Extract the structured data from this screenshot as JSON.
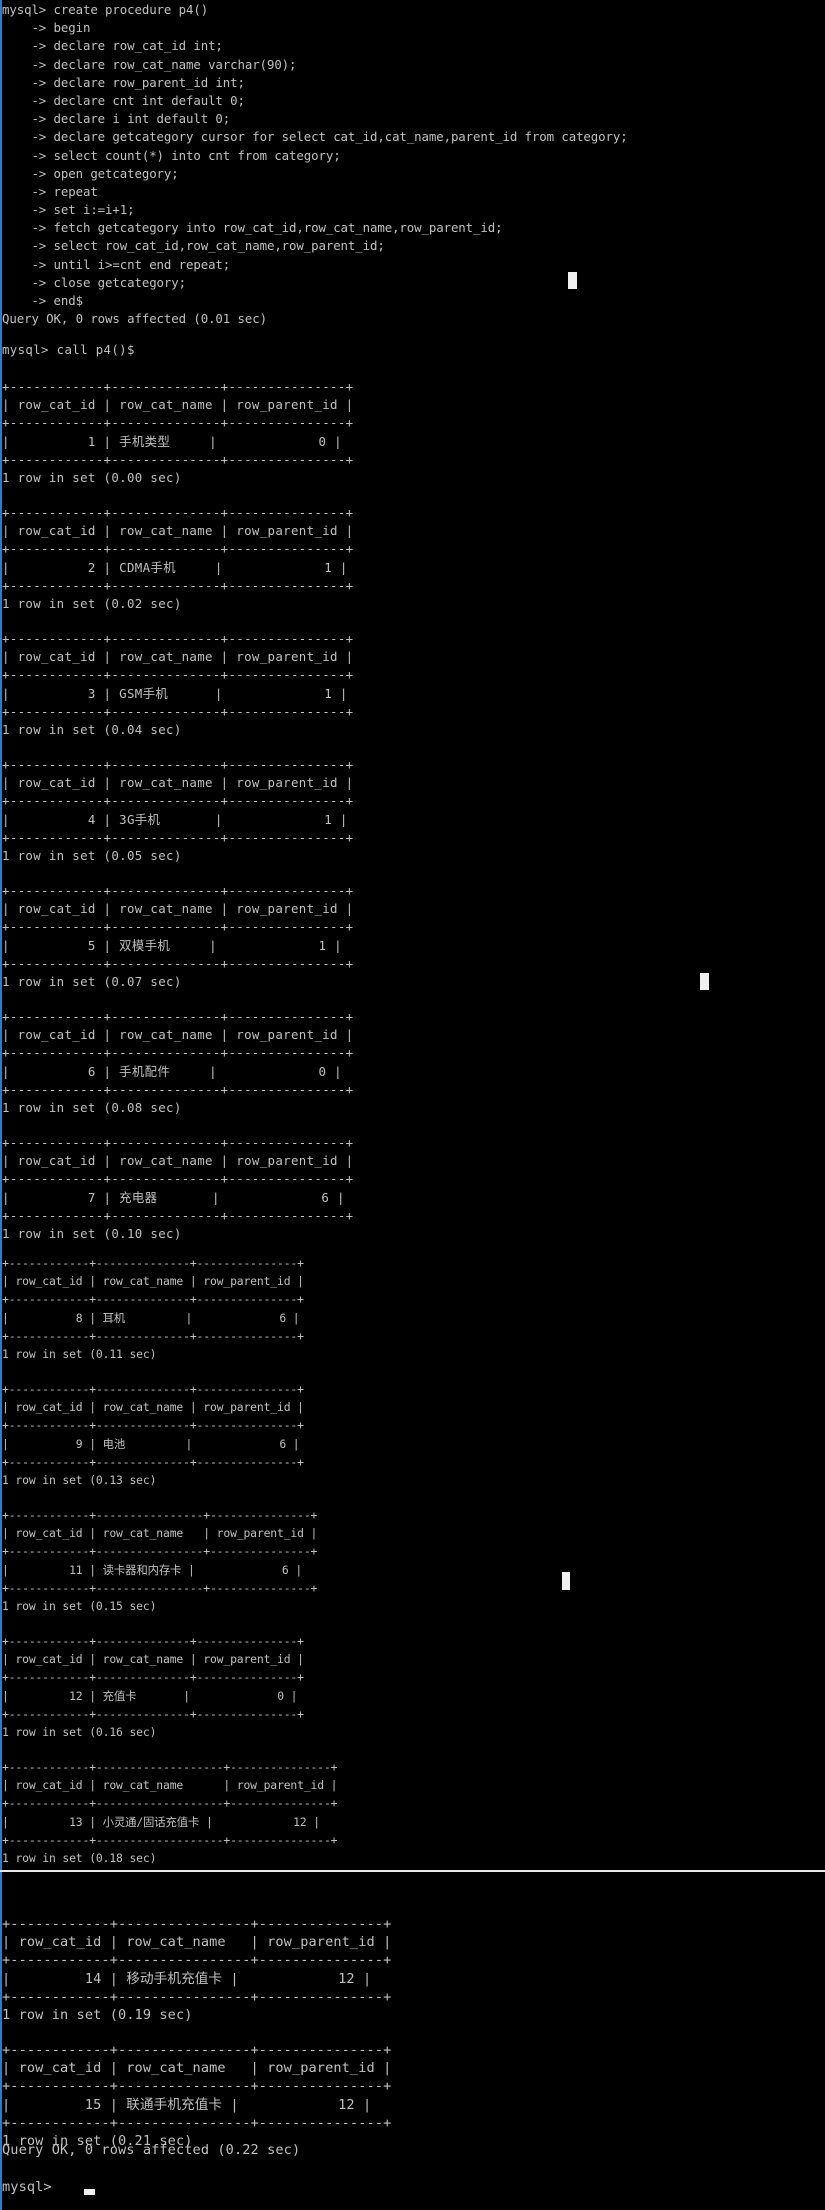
{
  "window": {
    "type": "mysql-console",
    "edge_color": "#3a78b8",
    "bg": "#000000",
    "fg": "#c0c0c0"
  },
  "procedure": {
    "lines": [
      "mysql> create procedure p4()",
      "    -> begin",
      "    -> declare row_cat_id int;",
      "    -> declare row_cat_name varchar(90);",
      "    -> declare row_parent_id int;",
      "    -> declare cnt int default 0;",
      "    -> declare i int default 0;",
      "    -> declare getcategory cursor for select cat_id,cat_name,parent_id from category;",
      "    -> select count(*) into cnt from category;",
      "    -> open getcategory;",
      "    -> repeat",
      "    -> set i:=i+1;",
      "    -> fetch getcategory into row_cat_id,row_cat_name,row_parent_id;",
      "    -> select row_cat_id,row_cat_name,row_parent_id;",
      "    -> until i>=cnt end repeat;",
      "    -> close getcategory;",
      "    -> end$",
      "Query OK, 0 rows affected (0.01 sec)"
    ]
  },
  "call_command": "mysql> call p4()$",
  "columns": [
    "row_cat_id",
    "row_cat_name",
    "row_parent_id"
  ],
  "results": [
    {
      "id": "1",
      "name": "手机类型",
      "parent": "0",
      "status": "1 row in set (0.00 sec)"
    },
    {
      "id": "2",
      "name": "CDMA手机",
      "parent": "1",
      "status": "1 row in set (0.02 sec)"
    },
    {
      "id": "3",
      "name": "GSM手机",
      "parent": "1",
      "status": "1 row in set (0.04 sec)"
    },
    {
      "id": "4",
      "name": "3G手机",
      "parent": "1",
      "status": "1 row in set (0.05 sec)"
    },
    {
      "id": "5",
      "name": "双模手机",
      "parent": "1",
      "status": "1 row in set (0.07 sec)"
    },
    {
      "id": "6",
      "name": "手机配件",
      "parent": "0",
      "status": "1 row in set (0.08 sec)"
    },
    {
      "id": "7",
      "name": "充电器",
      "parent": "6",
      "status": "1 row in set (0.10 sec)"
    },
    {
      "id": "8",
      "name": "耳机",
      "parent": "6",
      "status": "1 row in set (0.11 sec)"
    },
    {
      "id": "9",
      "name": "电池",
      "parent": "6",
      "status": "1 row in set (0.13 sec)"
    },
    {
      "id": "11",
      "name": "读卡器和内存卡",
      "parent": "6",
      "status": "1 row in set (0.15 sec)"
    },
    {
      "id": "12",
      "name": "充值卡",
      "parent": "0",
      "status": "1 row in set (0.16 sec)"
    },
    {
      "id": "13",
      "name": "小灵通/固话充值卡",
      "parent": "12",
      "status": "1 row in set (0.18 sec)"
    },
    {
      "id": "14",
      "name": "移动手机充值卡",
      "parent": "12",
      "status": "1 row in set (0.19 sec)"
    },
    {
      "id": "15",
      "name": "联通手机充值卡",
      "parent": "12",
      "status": "1 row in set (0.21 sec)"
    }
  ],
  "final_status": "Query OK, 0 rows affected (0.22 sec)",
  "prompt": "mysql> "
}
